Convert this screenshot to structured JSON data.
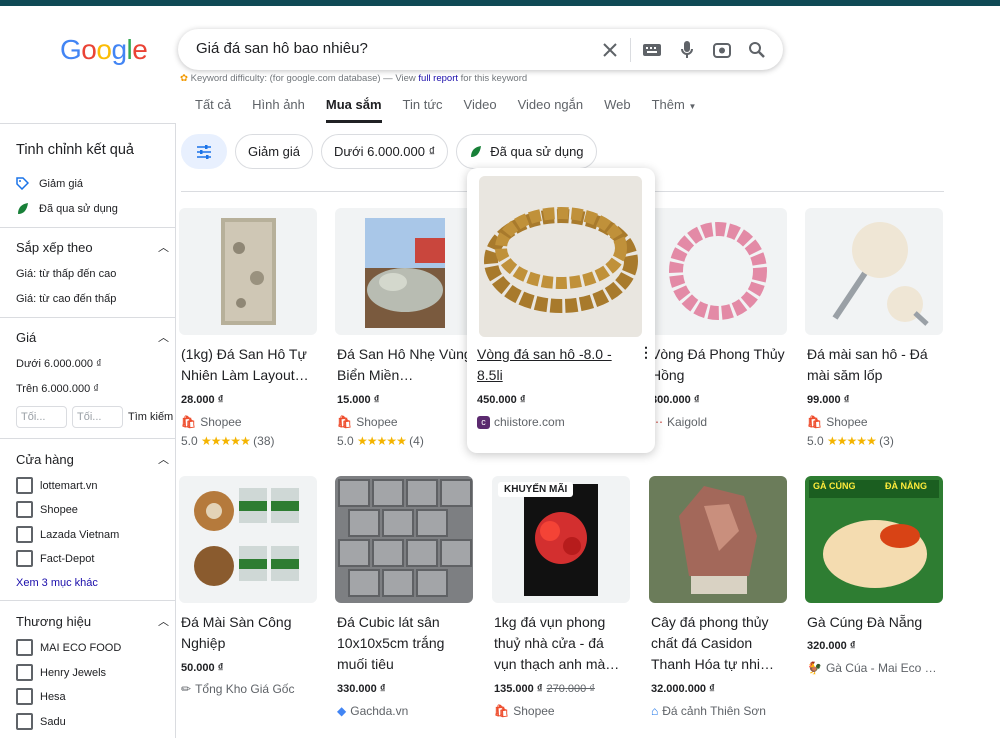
{
  "search": {
    "query": "Giá đá san hô bao nhiêu?"
  },
  "keyword_difficulty": {
    "label": "Keyword difficulty:",
    "note": "(for google.com database) — View",
    "link": "full report",
    "suffix": "for this keyword"
  },
  "tabs": [
    "Tất cả",
    "Hình ảnh",
    "Mua sắm",
    "Tin tức",
    "Video",
    "Video ngắn",
    "Web",
    "Thêm"
  ],
  "sidebar": {
    "title": "Tinh chỉnh kết quả",
    "quick": [
      "Giảm giá",
      "Đã qua sử dụng"
    ],
    "sort_title": "Sắp xếp theo",
    "sort_items": [
      "Giá: từ thấp đến cao",
      "Giá: từ cao đến thấp"
    ],
    "price_title": "Giá",
    "price_items": [
      "Dưới 6.000.000 ₫",
      "Trên 6.000.000 ₫"
    ],
    "price_min": "Tối...",
    "price_max": "Tối...",
    "price_search": "Tìm kiếm",
    "store_title": "Cửa hàng",
    "stores": [
      "lottemart.vn",
      "Shopee",
      "Lazada Vietnam",
      "Fact-Depot"
    ],
    "more_stores": "Xem 3 mục khác",
    "brand_title": "Thương hiệu",
    "brands": [
      "MAI ECO FOOD",
      "Henry Jewels",
      "Hesa",
      "Sadu"
    ]
  },
  "chips": [
    "Giảm giá",
    "Dưới 6.000.000 ₫",
    "Đã qua sử dụng"
  ],
  "products": [
    {
      "title": "(1kg) Đá San Hô Tự Nhiên Làm Layout…",
      "price": "28.000 ₫",
      "shop": "Shopee",
      "rating": "5.0",
      "reviews": "(38)"
    },
    {
      "title": "Đá San Hô Nhẹ Vùng Biển Miền…",
      "price": "15.000 ₫",
      "shop": "Shopee",
      "rating": "5.0",
      "reviews": "(4)"
    },
    {
      "title": "Vòng đá san hô -8.0 - 8.5li",
      "price": "450.000 ₫",
      "shop": "chiistore.com"
    },
    {
      "title": "Vòng Đá Phong Thủy Hồng",
      "price": "300.000 ₫",
      "shop": "Kaigold"
    },
    {
      "title": "Đá mài san hô - Đá mài săm lốp",
      "price": "99.000 ₫",
      "shop": "Shopee",
      "rating": "5.0",
      "reviews": "(3)"
    },
    {
      "title": "Đá Mài Sàn Công Nghiệp",
      "price": "50.000 ₫",
      "shop": "Tổng Kho Giá Gốc"
    },
    {
      "title": "Đá Cubic lát sân 10x10x5cm trắng muối tiêu",
      "price": "330.000 ₫",
      "shop": "Gachda.vn"
    },
    {
      "title": "1kg đá vụn phong thuỷ nhà cửa - đá vụn thạch anh mà…",
      "price": "135.000 ₫",
      "old_price": "270.000 ₫",
      "shop": "Shopee",
      "badge": "KHUYẾN MÃI"
    },
    {
      "title": "Cây đá phong thủy chất đá Casidon Thanh Hóa tự nhi…",
      "price": "32.000.000 ₫",
      "shop": "Đá cảnh Thiên Sơn"
    },
    {
      "title": "Gà Cúng Đà Nẵng",
      "price": "320.000 ₫",
      "shop": "Gà Cúa - Mai Eco …",
      "img_text_left": "GÀ CÚNG",
      "img_text_right": "ĐÀ NẴNG"
    }
  ],
  "stars": "★★★★★",
  "colors": {
    "topbar": "#0f4a55",
    "link": "#1a0dab",
    "chip_active": "#e8f0fe"
  }
}
